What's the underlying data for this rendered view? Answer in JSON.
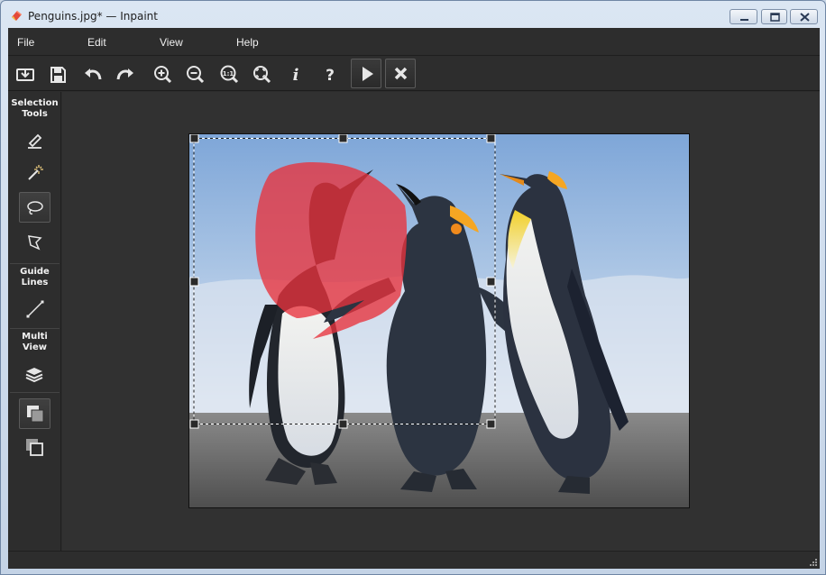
{
  "window": {
    "title": "Penguins.jpg* — Inpaint",
    "app_icon": "eraser-app-icon",
    "controls": [
      "minimize-icon",
      "maximize-icon",
      "close-icon"
    ]
  },
  "menu": {
    "items": [
      {
        "id": "file",
        "label": "File"
      },
      {
        "id": "edit",
        "label": "Edit"
      },
      {
        "id": "view",
        "label": "View"
      },
      {
        "id": "help",
        "label": "Help"
      }
    ]
  },
  "toolbar": {
    "buttons": [
      {
        "id": "open",
        "icon": "open-folder-icon"
      },
      {
        "id": "save",
        "icon": "floppy-disk-icon"
      },
      {
        "id": "undo",
        "icon": "undo-arrow-icon"
      },
      {
        "id": "redo",
        "icon": "redo-arrow-icon"
      },
      {
        "id": "zoom-in",
        "icon": "zoom-in-icon"
      },
      {
        "id": "zoom-out",
        "icon": "zoom-out-icon"
      },
      {
        "id": "zoom-actual",
        "icon": "zoom-actual-size-icon",
        "label": "1:1"
      },
      {
        "id": "zoom-fit",
        "icon": "zoom-fit-icon"
      },
      {
        "id": "info",
        "icon": "info-icon",
        "label": "i"
      },
      {
        "id": "help",
        "icon": "help-question-icon",
        "label": "?"
      },
      {
        "id": "run",
        "icon": "play-icon"
      },
      {
        "id": "cancel",
        "icon": "x-cancel-icon"
      }
    ]
  },
  "sidebar": {
    "sections": [
      {
        "label_line1": "Selection",
        "label_line2": "Tools"
      },
      {
        "label_line1": "Guide",
        "label_line2": "Lines"
      },
      {
        "label_line1": "Multi",
        "label_line2": "View"
      }
    ],
    "tools": [
      {
        "id": "marker",
        "icon": "marker-pen-icon",
        "active": false
      },
      {
        "id": "magic-wand",
        "icon": "magic-wand-icon",
        "active": false
      },
      {
        "id": "lasso",
        "icon": "lasso-icon",
        "active": true
      },
      {
        "id": "polygonal-lasso",
        "icon": "polygonal-lasso-icon",
        "active": false
      },
      {
        "id": "guide-line",
        "icon": "guide-line-icon",
        "active": false
      },
      {
        "id": "layers",
        "icon": "layers-icon",
        "active": false
      },
      {
        "id": "view-mode-1",
        "icon": "stacked-squares-front-icon",
        "active": true
      },
      {
        "id": "view-mode-2",
        "icon": "stacked-squares-back-icon",
        "active": false
      }
    ]
  },
  "canvas": {
    "image_subject": "emperor-penguins",
    "selection_mask_color": "#e8323c",
    "sky_color": "#a9c4e4",
    "sand_color": "#5f5f5f"
  },
  "colors": {
    "chrome_bg": "#2d2d2d",
    "canvas_bg": "#313131",
    "icon": "#e6e6e6"
  }
}
